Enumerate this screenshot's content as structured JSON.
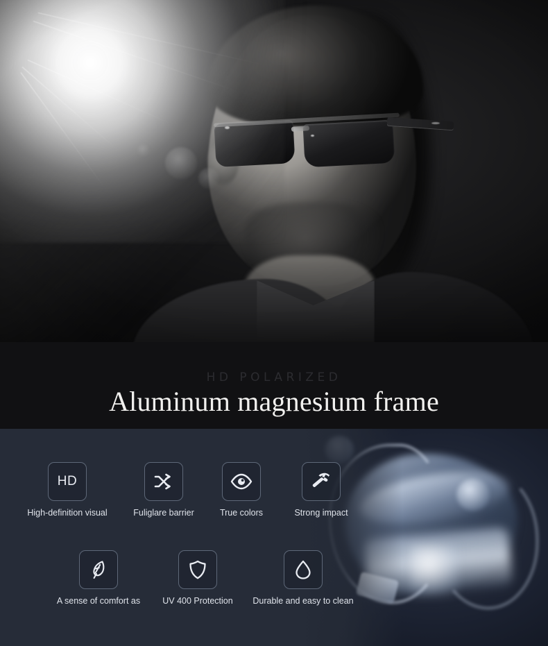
{
  "hero": {
    "alt": "man wearing polarized sunglasses, black and white portrait",
    "icon_light": "sun-flare",
    "icon_person": "man-with-sunglasses"
  },
  "band": {
    "subtitle": "HD POLARIZED",
    "title": "Aluminum magnesium frame"
  },
  "features": {
    "product_image_alt": "close-up of aluminum magnesium sunglasses frame",
    "rows": [
      [
        {
          "icon": "hd-icon",
          "glyph": "HD",
          "label": "High-definition visual"
        },
        {
          "icon": "shuffle-icon",
          "glyph": "",
          "label": "Fuliglare barrier"
        },
        {
          "icon": "eye-icon",
          "glyph": "",
          "label": "True colors"
        },
        {
          "icon": "hammer-icon",
          "glyph": "",
          "label": "Strong impact"
        }
      ],
      [
        {
          "icon": "feather-icon",
          "glyph": "",
          "label": "A sense of comfort as"
        },
        {
          "icon": "shield-icon",
          "glyph": "",
          "label": "UV 400 Protection"
        },
        {
          "icon": "droplet-icon",
          "glyph": "",
          "label": "Durable and easy to clean"
        }
      ]
    ]
  },
  "colors": {
    "panel_bg": "#262c38",
    "band_bg": "#111113",
    "title_text": "#f2f1ef",
    "subtitle_text": "#2c2c30",
    "icon_stroke": "#e9ecf2",
    "icon_border": "#5e6878",
    "label_text": "#dfe3ea"
  }
}
